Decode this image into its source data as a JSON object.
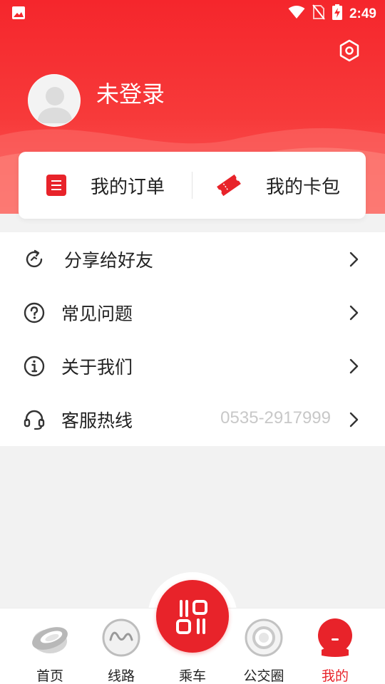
{
  "status_bar": {
    "time": "2:49"
  },
  "profile": {
    "login_status": "未登录"
  },
  "quick_card": {
    "orders_label": "我的订单",
    "wallet_label": "我的卡包"
  },
  "menu": {
    "share_label": "分享给好友",
    "faq_label": "常见问题",
    "about_label": "关于我们",
    "hotline_label": "客服热线",
    "hotline_number": "0535-2917999"
  },
  "tabs": [
    {
      "label": "首页",
      "icon": "home-icon"
    },
    {
      "label": "线路",
      "icon": "route-icon"
    },
    {
      "label": "乘车",
      "icon": "qr-code-icon"
    },
    {
      "label": "公交圈",
      "icon": "circle-icon"
    },
    {
      "label": "我的",
      "icon": "profile-icon"
    }
  ],
  "colors": {
    "brand_red": "#e8232a",
    "header_red": "#f5262c",
    "hotline_gray": "#c8c8c8"
  }
}
